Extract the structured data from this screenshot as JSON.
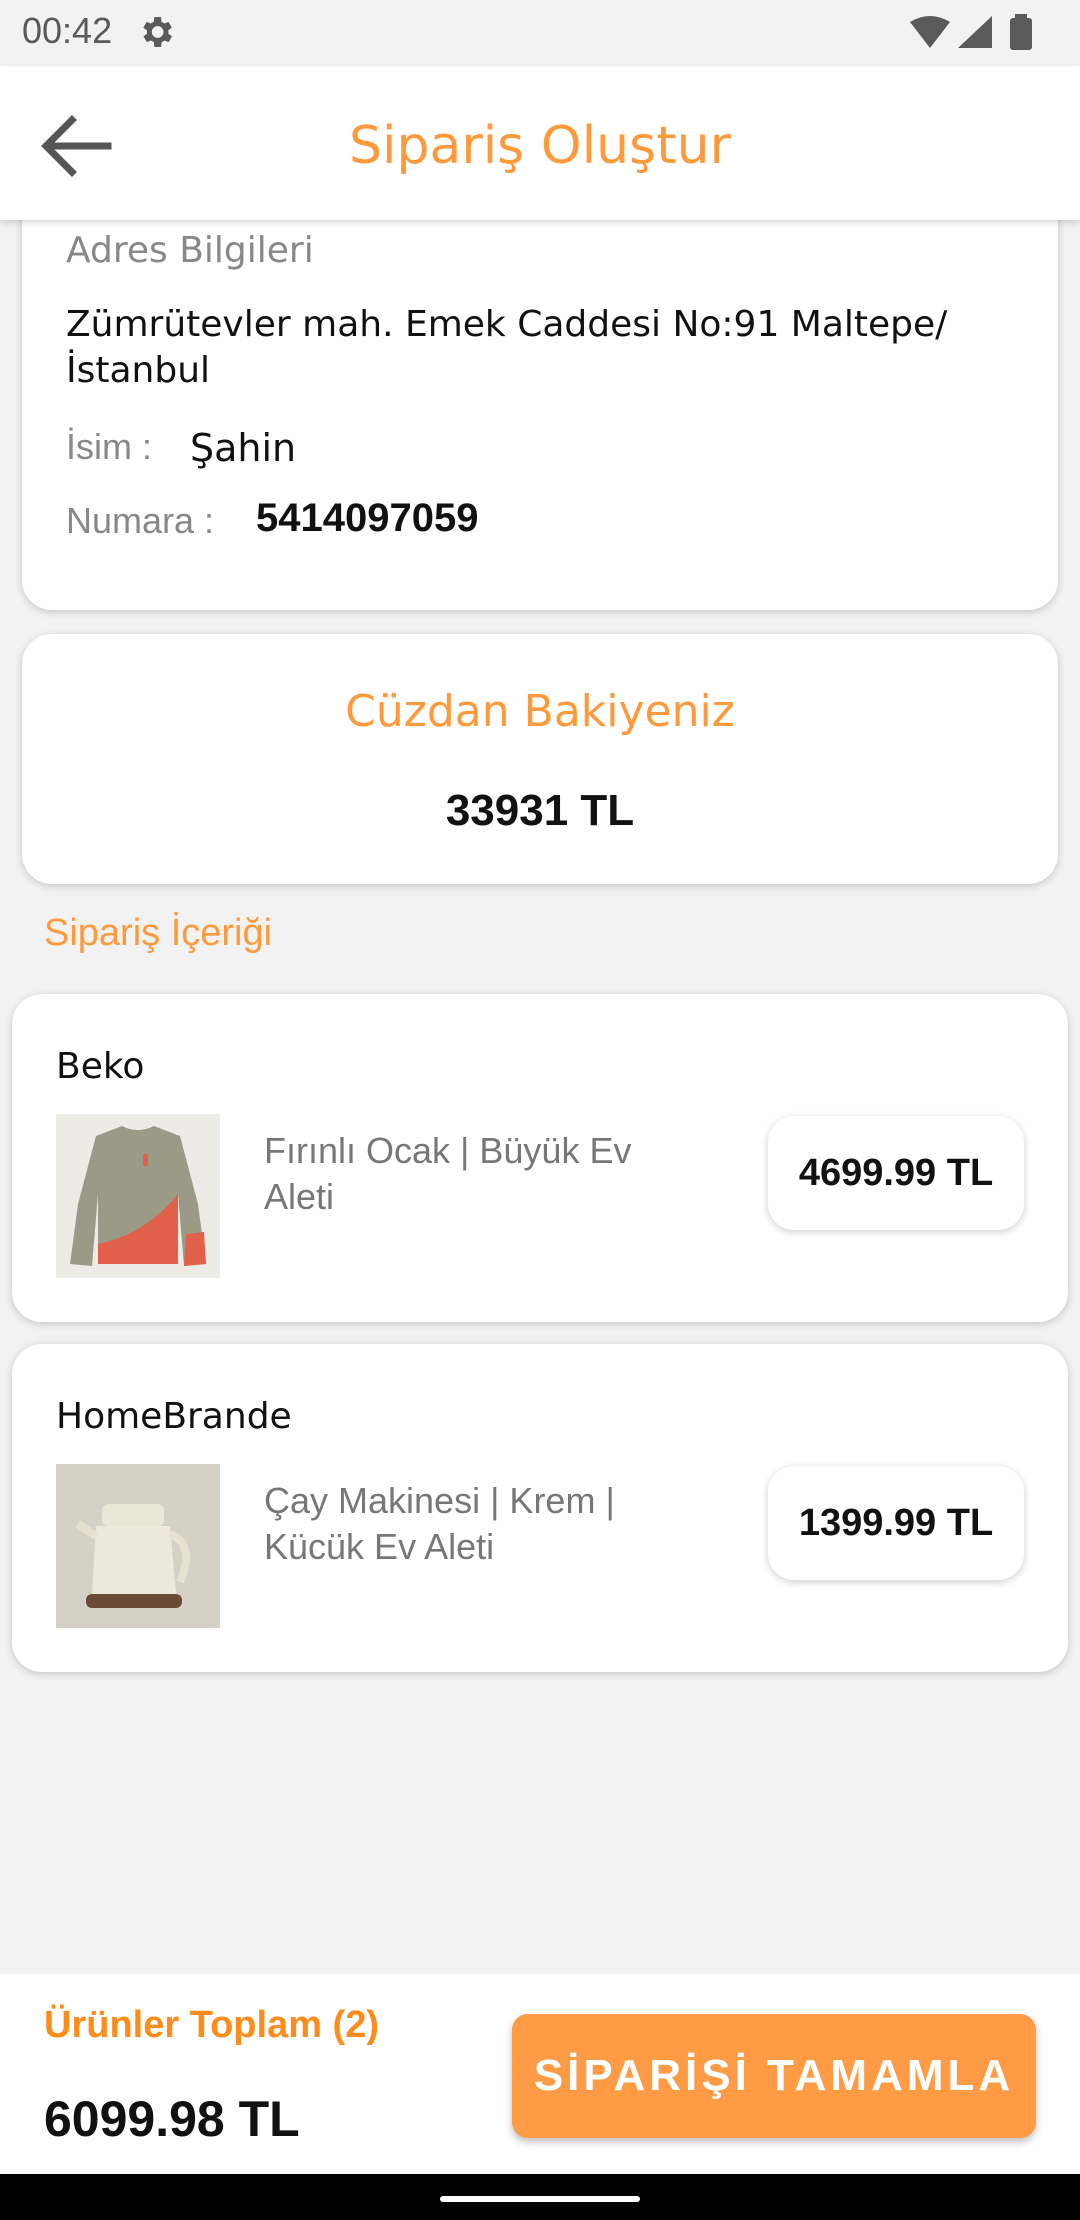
{
  "status_bar": {
    "time": "00:42"
  },
  "header": {
    "title": "Sipariş Oluştur"
  },
  "address_card": {
    "heading": "Adres Bilgileri",
    "address": "Zümrütevler mah. Emek Caddesi No:91 Maltepe/ İstanbul",
    "name_label": "İsim :",
    "name_value": "Şahin",
    "number_label": "Numara :",
    "number_value": "5414097059"
  },
  "wallet": {
    "title": "Cüzdan Bakiyeniz",
    "amount": "33931 TL"
  },
  "order_section": {
    "title": "Sipariş İçeriği"
  },
  "items": [
    {
      "brand": "Beko",
      "description": "Fırınlı Ocak | Büyük  Ev Aleti",
      "price": "4699.99 TL"
    },
    {
      "brand": "HomeBrande",
      "description": "Çay Makinesi | Krem | Kücük Ev Aleti",
      "price": "1399.99 TL"
    }
  ],
  "summary": {
    "total_label": "Ürünler Toplam (2)",
    "total_value": "6099.98 TL",
    "complete_button": "SİPARİŞİ TAMAMLA"
  },
  "colors": {
    "accent": "#ff9a3c",
    "button": "#ff9a45"
  }
}
